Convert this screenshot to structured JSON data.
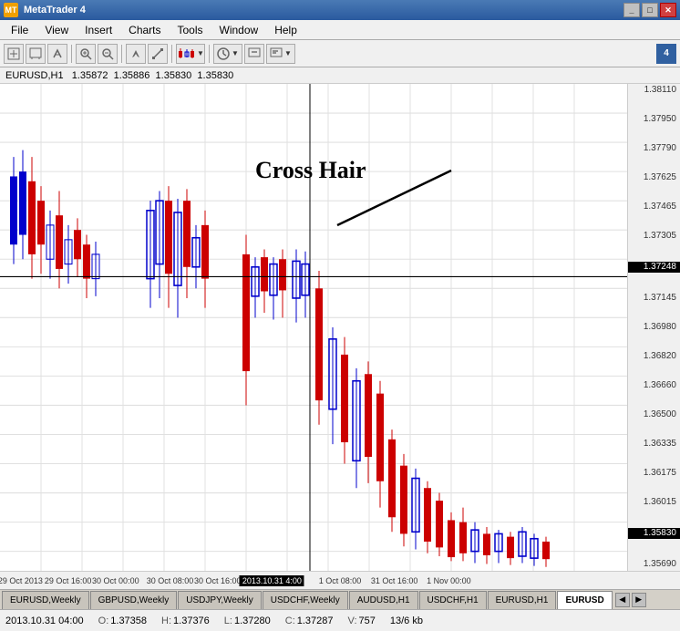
{
  "titleBar": {
    "icon": "MT",
    "title": "MetaTrader 4",
    "minimize": "_",
    "maximize": "□",
    "close": "✕"
  },
  "menuBar": {
    "items": [
      "File",
      "View",
      "Insert",
      "Charts",
      "Tools",
      "Window",
      "Help"
    ]
  },
  "chartInfoBar": {
    "symbol": "EURUSD,H1",
    "bid": "1.35872",
    "ask1": "1.35886",
    "price2": "1.35830",
    "price3": "1.35830"
  },
  "crosshairLabel": "Cross Hair",
  "priceScale": {
    "prices": [
      "1.38110",
      "1.37950",
      "1.37790",
      "1.37625",
      "1.37465",
      "1.37305",
      "1.37248",
      "1.37145",
      "1.36980",
      "1.36820",
      "1.36660",
      "1.36500",
      "1.36335",
      "1.36175",
      "1.36015",
      "1.35830",
      "1.35690"
    ],
    "highlighted": "1.37248",
    "highlighted2": "1.35830"
  },
  "timeAxis": {
    "labels": [
      {
        "text": "29 Oct 2013",
        "pos": 3
      },
      {
        "text": "29 Oct 16:00",
        "pos": 9.5
      },
      {
        "text": "30 Oct 00:00",
        "pos": 17
      },
      {
        "text": "30 Oct 08:00",
        "pos": 24.5
      },
      {
        "text": "30 Oct 16:00",
        "pos": 32
      },
      {
        "text": "2013.10.31 4:00",
        "pos": 39.5,
        "highlighted": true
      },
      {
        "text": "1 Oct 08:00",
        "pos": 50
      },
      {
        "text": "31 Oct 16:00",
        "pos": 58
      },
      {
        "text": "1 Nov 00:00",
        "pos": 65.5
      }
    ]
  },
  "tabs": [
    {
      "label": "EURUSD,Weekly",
      "active": false
    },
    {
      "label": "GBPUSD,Weekly",
      "active": false
    },
    {
      "label": "USDJPY,Weekly",
      "active": false
    },
    {
      "label": "USDCHF,Weekly",
      "active": false
    },
    {
      "label": "AUDUSD,H1",
      "active": false
    },
    {
      "label": "USDCHF,H1",
      "active": false
    },
    {
      "label": "EURUSD,H1",
      "active": false
    },
    {
      "label": "EURUSD",
      "active": true
    }
  ],
  "statusBar": {
    "datetime": "2013.10.31 04:00",
    "openLabel": "O:",
    "open": "1.37358",
    "highLabel": "H:",
    "high": "1.37376",
    "lowLabel": "L:",
    "low": "1.37280",
    "closeLabel": "C:",
    "close": "1.37287",
    "volumeLabel": "V:",
    "volume": "757",
    "sizeLabel": "13/6 kb"
  },
  "toolbar": {
    "cornerLabel": "4"
  }
}
